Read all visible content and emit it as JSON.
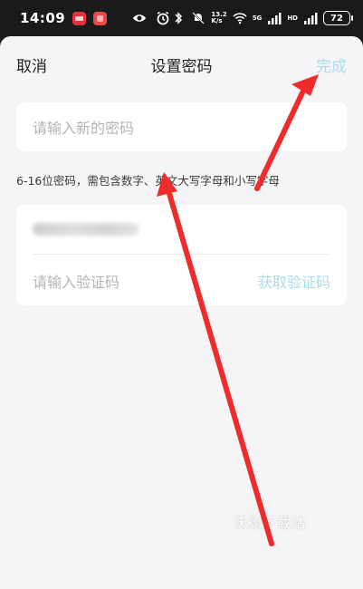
{
  "status_bar": {
    "time": "14:09",
    "signal_badge_1": "5G",
    "signal_badge_2": "HD",
    "battery": "72"
  },
  "nav": {
    "cancel_label": "取消",
    "title": "设置密码",
    "done_label": "完成"
  },
  "new_password": {
    "placeholder": "请输入新的密码"
  },
  "hint": "6-16位密码，需包含数字、英文大写字母和小写字母",
  "verify": {
    "code_placeholder": "请输入验证码",
    "get_code_label": "获取验证码"
  },
  "watermark": "沃德下载站",
  "colors": {
    "accent": "#a9dbea",
    "arrow": "#ee2c2c",
    "background": "#f5f5f7"
  }
}
